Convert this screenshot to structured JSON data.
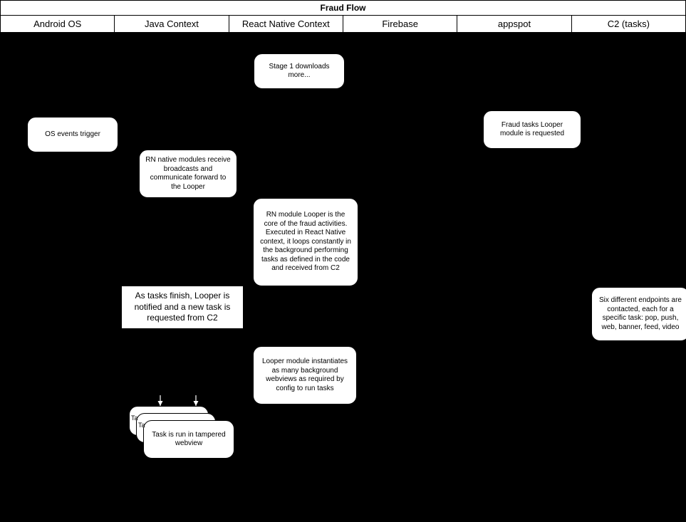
{
  "title": "Fraud Flow",
  "lanes": [
    "Android OS",
    "Java Context",
    "React Native Context",
    "Firebase",
    "appspot",
    "C2 (tasks)"
  ],
  "nodes": {
    "stage1": "Stage 1 downloads more...",
    "osEvents": "OS events trigger",
    "fraudTasksReq": "Fraud tasks Looper module is requested",
    "rnBroadcast": "RN native modules receive broadcasts and communicate forward to the Looper",
    "looperCore": "RN module Looper is the core of the fraud activities. Executed in React Native context, it loops constantly in the background performing tasks as defined in the code and received from C2",
    "sixEndpoints": "Six different endpoints are contacted, each for a specific task: pop, push, web, banner, feed, video",
    "looperWebviews": "Looper module instantiates as many background webviews as required by config to run tasks",
    "tampered": "Task is run in tampered webview",
    "stackLabelA": "Ta",
    "stackLabelB": "Ta"
  },
  "note": "As tasks finish, Looper is notified and a new task is requested from C2"
}
